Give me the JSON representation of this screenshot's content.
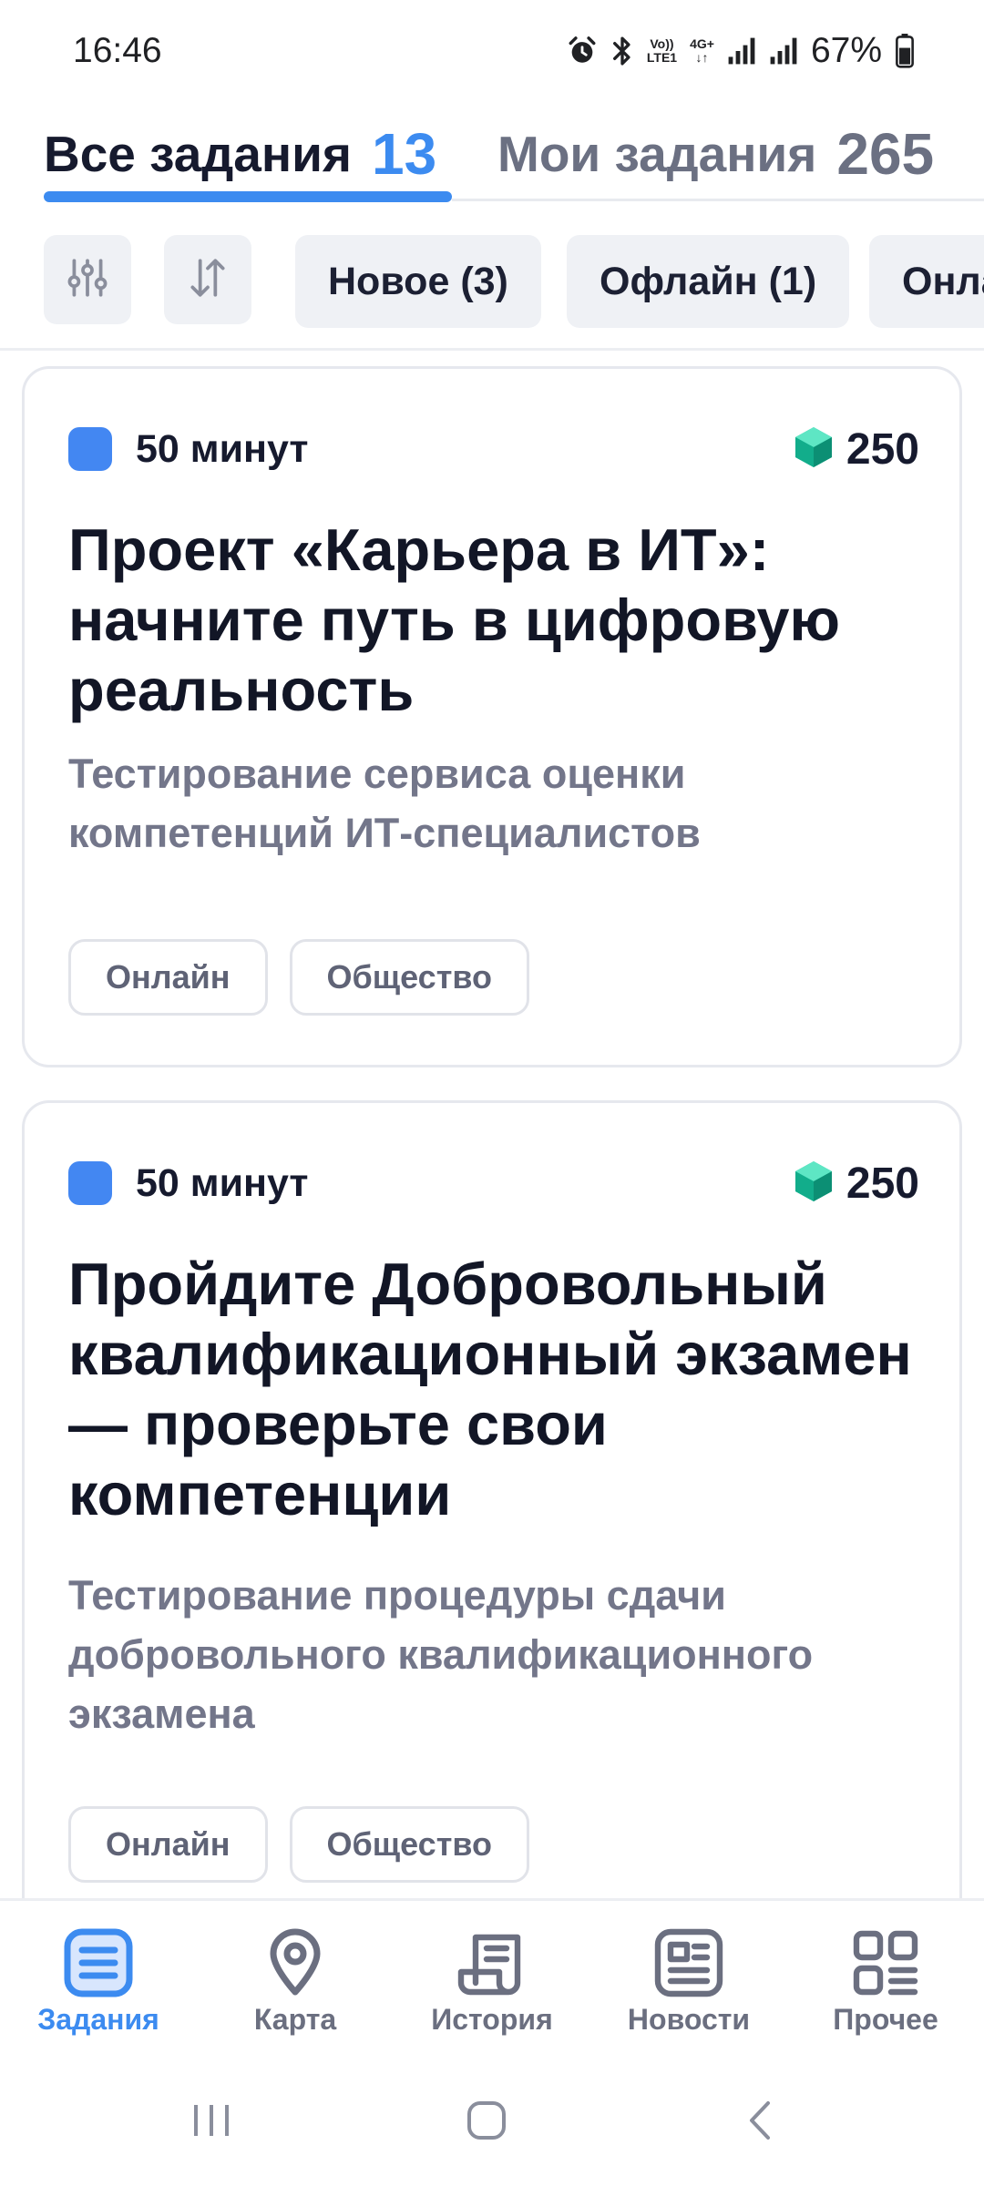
{
  "status_bar": {
    "time": "16:46",
    "volte_top": "Vo))",
    "volte_bottom": "LTE1",
    "network": "4G+",
    "battery": "67%"
  },
  "tabs": [
    {
      "label": "Все задания",
      "count": "13",
      "active": true
    },
    {
      "label": "Мои задания",
      "count": "265",
      "active": false
    }
  ],
  "filters": {
    "filter_icon": "sliders-icon",
    "sort_icon": "sort-icon",
    "chips": [
      "Новое (3)",
      "Офлайн (1)",
      "Онлайн"
    ]
  },
  "tasks": [
    {
      "duration": "50 минут",
      "points": "250",
      "title": "Проект «Карьера в ИТ»: начните путь в цифровую реальность",
      "description": "Тестирование сервиса оценки компетенций ИТ-специалистов",
      "tags": [
        "Онлайн",
        "Общество"
      ]
    },
    {
      "duration": "50 минут",
      "points": "250",
      "title": "Пройдите Добровольный квалификационный экзамен — проверьте свои компетенции",
      "description": "Тестирование процедуры сдачи добровольного квалификационного экзамена",
      "tags": [
        "Онлайн",
        "Общество"
      ]
    }
  ],
  "bottom_nav": [
    {
      "label": "Задания",
      "icon": "list-icon",
      "active": true
    },
    {
      "label": "Карта",
      "icon": "map-pin-icon",
      "active": false
    },
    {
      "label": "История",
      "icon": "history-icon",
      "active": false
    },
    {
      "label": "Новости",
      "icon": "news-icon",
      "active": false
    },
    {
      "label": "Прочее",
      "icon": "more-icon",
      "active": false
    }
  ],
  "colors": {
    "accent": "#3c8bf0",
    "dot": "#4387f2",
    "gem": "#17c9a0",
    "text_primary": "#161a2e",
    "text_secondary": "#73768a",
    "chip_bg": "#eff1f5"
  }
}
